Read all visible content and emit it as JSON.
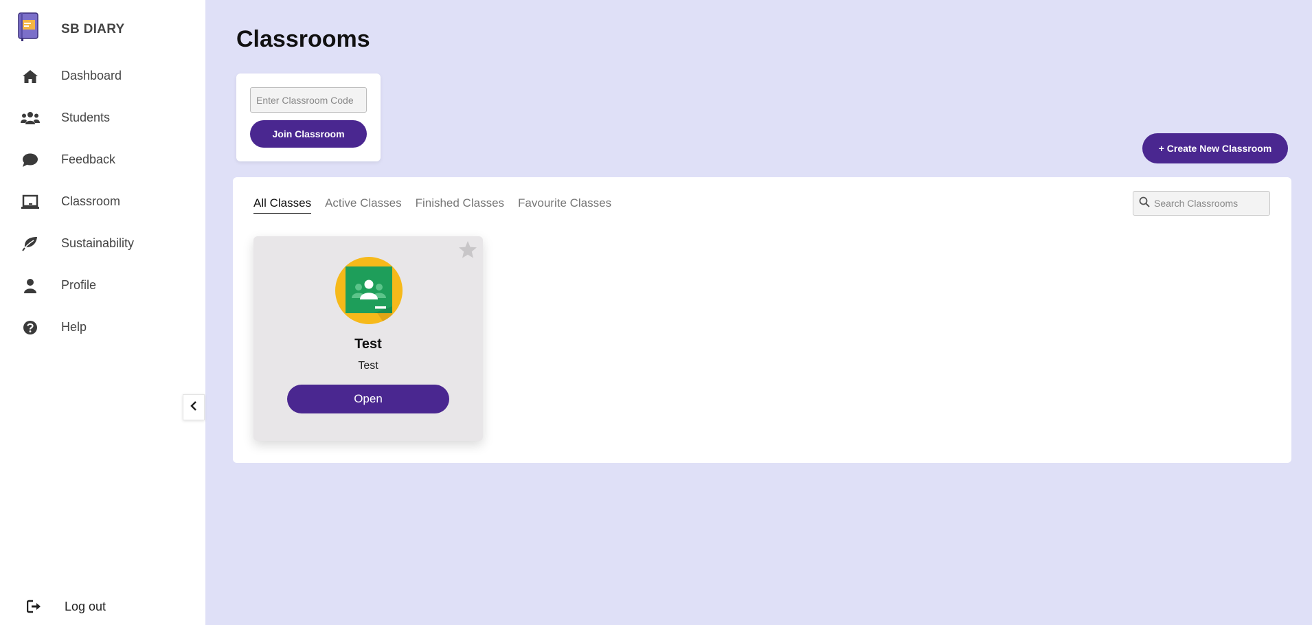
{
  "sidebar": {
    "brand": "SB DIARY",
    "items": [
      {
        "label": "Dashboard",
        "icon": "home-icon"
      },
      {
        "label": "Students",
        "icon": "users-icon"
      },
      {
        "label": "Feedback",
        "icon": "comment-icon"
      },
      {
        "label": "Classroom",
        "icon": "laptop-icon"
      },
      {
        "label": "Sustainability",
        "icon": "leaf-icon"
      },
      {
        "label": "Profile",
        "icon": "user-icon"
      },
      {
        "label": "Help",
        "icon": "question-circle-icon"
      }
    ],
    "logout": "Log out"
  },
  "page": {
    "title": "Classrooms"
  },
  "join": {
    "placeholder": "Enter Classroom Code",
    "button": "Join Classroom"
  },
  "create_button": "+ Create New Classroom",
  "tabs": [
    {
      "label": "All Classes",
      "active": true
    },
    {
      "label": "Active Classes",
      "active": false
    },
    {
      "label": "Finished Classes",
      "active": false
    },
    {
      "label": "Favourite Classes",
      "active": false
    }
  ],
  "search": {
    "placeholder": "Search Classrooms"
  },
  "classes": [
    {
      "name": "Test",
      "subtitle": "Test",
      "button": "Open",
      "favourite": false
    }
  ],
  "colors": {
    "accent": "#4a2790",
    "background": "#dfe0f7",
    "card": "#e8e6e8",
    "avatar_bg": "#f6b91a",
    "classroom_green": "#1e9e5a"
  }
}
